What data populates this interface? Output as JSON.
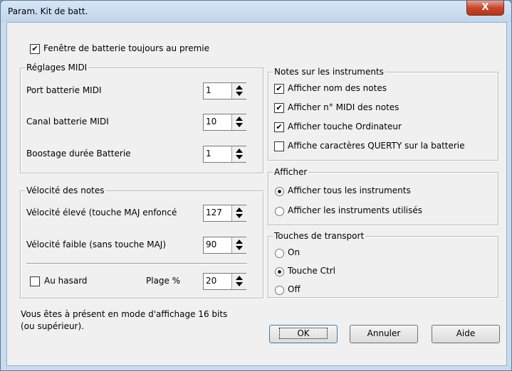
{
  "window": {
    "title": "Param. Kit de batt.",
    "close_symbol": "X"
  },
  "top_checkbox": {
    "label": "Fenêtre de batterie toujours au premie",
    "checked": true
  },
  "midi": {
    "title": "Réglages MIDI",
    "rows": [
      {
        "label": "Port batterie MIDI",
        "value": "1"
      },
      {
        "label": "Canal batterie MIDI",
        "value": "10"
      },
      {
        "label": "Boostage durée Batterie",
        "value": "1"
      }
    ]
  },
  "velocity": {
    "title": "Vélocité des notes",
    "high_label": "Vélocité élevé (touche MAJ enfoncé",
    "high_value": "127",
    "low_label": "Vélocité faible (sans touche MAJ)",
    "low_value": "90",
    "random_label": "Au hasard",
    "random_checked": false,
    "range_label": "Plage %",
    "range_value": "20"
  },
  "notes": {
    "title": "Notes sur les instruments",
    "items": [
      {
        "label": "Afficher nom des notes",
        "checked": true
      },
      {
        "label": "Afficher n° MIDI des notes",
        "checked": true
      },
      {
        "label": "Afficher touche Ordinateur",
        "checked": true
      },
      {
        "label": "Affiche caractères QUERTY sur la batterie",
        "checked": false
      }
    ]
  },
  "display": {
    "title": "Afficher",
    "options": [
      {
        "label": "Afficher tous les instruments",
        "selected": true
      },
      {
        "label": "Afficher les instruments utilisés",
        "selected": false
      }
    ]
  },
  "transport": {
    "title": "Touches de transport",
    "options": [
      {
        "label": "On",
        "selected": false
      },
      {
        "label": "Touche Ctrl",
        "selected": true
      },
      {
        "label": "Off",
        "selected": false
      }
    ]
  },
  "info": {
    "line1": "Vous êtes à présent en mode d'affichage 16 bits",
    "line2": "(ou supérieur)."
  },
  "buttons": {
    "ok": "OK",
    "cancel": "Annuler",
    "help": "Aide"
  },
  "check_mark": "✔"
}
